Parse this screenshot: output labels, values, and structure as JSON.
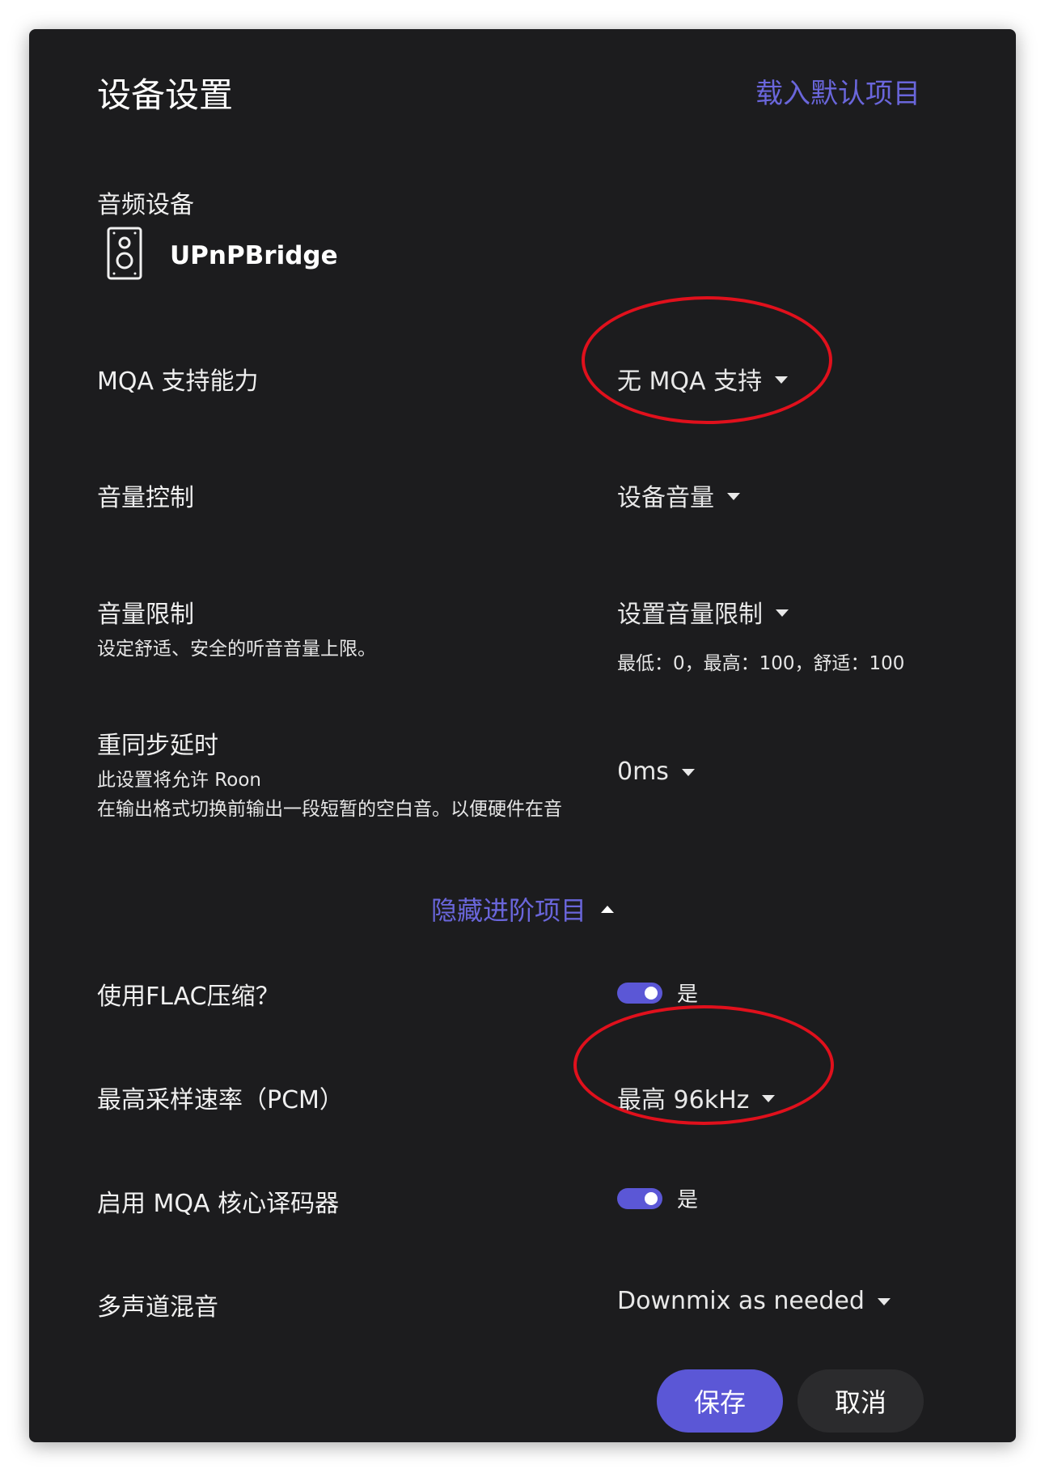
{
  "dialog": {
    "title": "设备设置",
    "load_defaults": "载入默认项目"
  },
  "audio_device": {
    "label": "音频设备",
    "icon": "speaker-icon",
    "name": "UPnPBridge"
  },
  "mqa_capability": {
    "label": "MQA 支持能力",
    "value": "无 MQA 支持"
  },
  "volume_control": {
    "label": "音量控制",
    "value": "设备音量"
  },
  "volume_limit": {
    "label": "音量限制",
    "description": "设定舒适、安全的听音音量上限。",
    "value": "设置音量限制",
    "info": "最低：0，最高：100，舒适：100"
  },
  "resync_delay": {
    "label": "重同步延时",
    "description_line1": "此设置将允许 Roon",
    "description_line2": "在输出格式切换前输出一段短暂的空白音。以便硬件在音",
    "value": "0ms"
  },
  "advanced": {
    "toggle_label": "隐藏进阶项目"
  },
  "flac_compression": {
    "label": "使用FLAC压缩？",
    "value": "是",
    "enabled": true
  },
  "max_sample_rate": {
    "label": "最高采样速率（PCM）",
    "value": "最高 96kHz"
  },
  "mqa_core_decoder": {
    "label": "启用 MQA 核心译码器",
    "value": "是",
    "enabled": true
  },
  "multichannel_mix": {
    "label": "多声道混音",
    "value": "Downmix as needed"
  },
  "buttons": {
    "save": "保存",
    "cancel": "取消"
  },
  "colors": {
    "background": "#1c1c1e",
    "accent": "#5b57d6",
    "link": "#6a66db",
    "annotation": "#e0101c"
  }
}
